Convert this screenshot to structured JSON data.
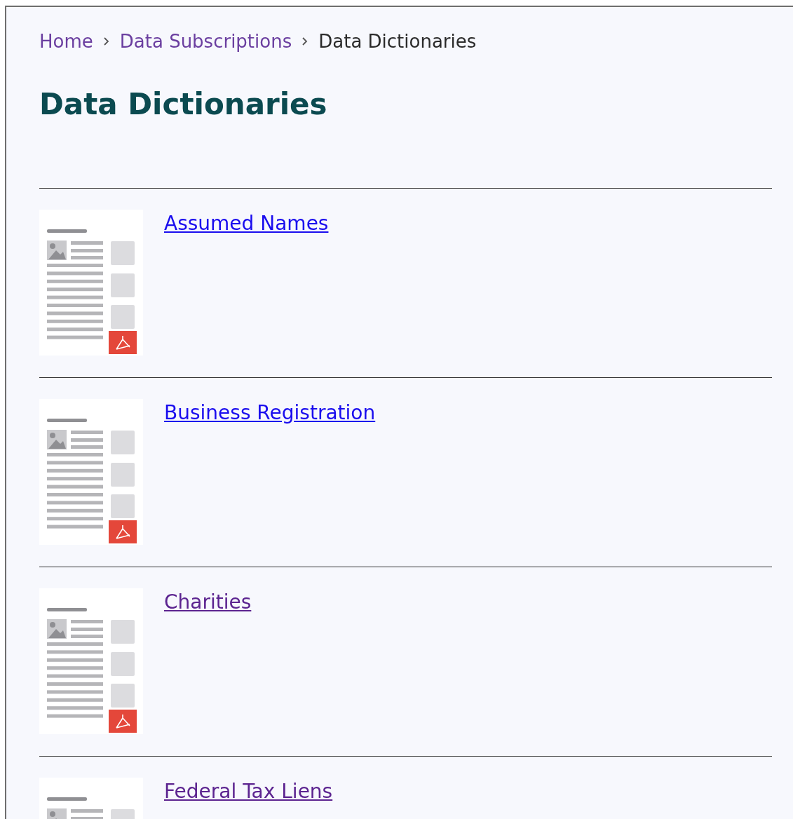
{
  "breadcrumb": [
    {
      "label": "Home",
      "current": false
    },
    {
      "label": "Data Subscriptions",
      "current": false
    },
    {
      "label": "Data Dictionaries",
      "current": true
    }
  ],
  "heading": "Data Dictionaries",
  "documents": [
    {
      "title": "Assumed Names",
      "visited": false
    },
    {
      "title": "Business Registration",
      "visited": false
    },
    {
      "title": "Charities",
      "visited": true
    },
    {
      "title": "Federal Tax Liens",
      "visited": true
    }
  ]
}
